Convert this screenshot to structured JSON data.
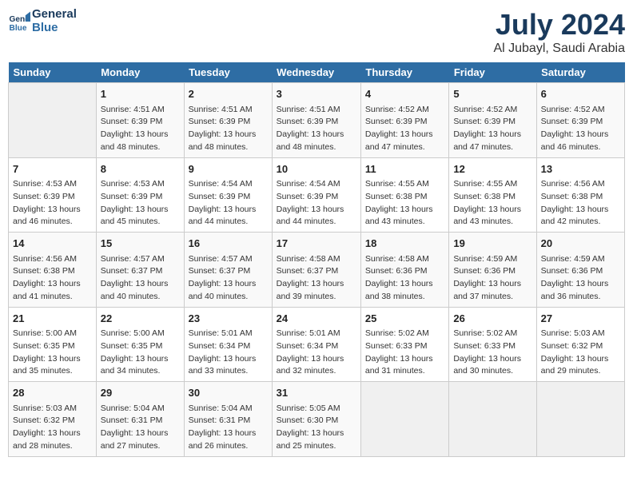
{
  "header": {
    "logo_line1": "General",
    "logo_line2": "Blue",
    "month": "July 2024",
    "location": "Al Jubayl, Saudi Arabia"
  },
  "weekdays": [
    "Sunday",
    "Monday",
    "Tuesday",
    "Wednesday",
    "Thursday",
    "Friday",
    "Saturday"
  ],
  "weeks": [
    [
      {
        "day": "",
        "sunrise": "",
        "sunset": "",
        "daylight": ""
      },
      {
        "day": "1",
        "sunrise": "Sunrise: 4:51 AM",
        "sunset": "Sunset: 6:39 PM",
        "daylight": "Daylight: 13 hours and 48 minutes."
      },
      {
        "day": "2",
        "sunrise": "Sunrise: 4:51 AM",
        "sunset": "Sunset: 6:39 PM",
        "daylight": "Daylight: 13 hours and 48 minutes."
      },
      {
        "day": "3",
        "sunrise": "Sunrise: 4:51 AM",
        "sunset": "Sunset: 6:39 PM",
        "daylight": "Daylight: 13 hours and 48 minutes."
      },
      {
        "day": "4",
        "sunrise": "Sunrise: 4:52 AM",
        "sunset": "Sunset: 6:39 PM",
        "daylight": "Daylight: 13 hours and 47 minutes."
      },
      {
        "day": "5",
        "sunrise": "Sunrise: 4:52 AM",
        "sunset": "Sunset: 6:39 PM",
        "daylight": "Daylight: 13 hours and 47 minutes."
      },
      {
        "day": "6",
        "sunrise": "Sunrise: 4:52 AM",
        "sunset": "Sunset: 6:39 PM",
        "daylight": "Daylight: 13 hours and 46 minutes."
      }
    ],
    [
      {
        "day": "7",
        "sunrise": "Sunrise: 4:53 AM",
        "sunset": "Sunset: 6:39 PM",
        "daylight": "Daylight: 13 hours and 46 minutes."
      },
      {
        "day": "8",
        "sunrise": "Sunrise: 4:53 AM",
        "sunset": "Sunset: 6:39 PM",
        "daylight": "Daylight: 13 hours and 45 minutes."
      },
      {
        "day": "9",
        "sunrise": "Sunrise: 4:54 AM",
        "sunset": "Sunset: 6:39 PM",
        "daylight": "Daylight: 13 hours and 44 minutes."
      },
      {
        "day": "10",
        "sunrise": "Sunrise: 4:54 AM",
        "sunset": "Sunset: 6:39 PM",
        "daylight": "Daylight: 13 hours and 44 minutes."
      },
      {
        "day": "11",
        "sunrise": "Sunrise: 4:55 AM",
        "sunset": "Sunset: 6:38 PM",
        "daylight": "Daylight: 13 hours and 43 minutes."
      },
      {
        "day": "12",
        "sunrise": "Sunrise: 4:55 AM",
        "sunset": "Sunset: 6:38 PM",
        "daylight": "Daylight: 13 hours and 43 minutes."
      },
      {
        "day": "13",
        "sunrise": "Sunrise: 4:56 AM",
        "sunset": "Sunset: 6:38 PM",
        "daylight": "Daylight: 13 hours and 42 minutes."
      }
    ],
    [
      {
        "day": "14",
        "sunrise": "Sunrise: 4:56 AM",
        "sunset": "Sunset: 6:38 PM",
        "daylight": "Daylight: 13 hours and 41 minutes."
      },
      {
        "day": "15",
        "sunrise": "Sunrise: 4:57 AM",
        "sunset": "Sunset: 6:37 PM",
        "daylight": "Daylight: 13 hours and 40 minutes."
      },
      {
        "day": "16",
        "sunrise": "Sunrise: 4:57 AM",
        "sunset": "Sunset: 6:37 PM",
        "daylight": "Daylight: 13 hours and 40 minutes."
      },
      {
        "day": "17",
        "sunrise": "Sunrise: 4:58 AM",
        "sunset": "Sunset: 6:37 PM",
        "daylight": "Daylight: 13 hours and 39 minutes."
      },
      {
        "day": "18",
        "sunrise": "Sunrise: 4:58 AM",
        "sunset": "Sunset: 6:36 PM",
        "daylight": "Daylight: 13 hours and 38 minutes."
      },
      {
        "day": "19",
        "sunrise": "Sunrise: 4:59 AM",
        "sunset": "Sunset: 6:36 PM",
        "daylight": "Daylight: 13 hours and 37 minutes."
      },
      {
        "day": "20",
        "sunrise": "Sunrise: 4:59 AM",
        "sunset": "Sunset: 6:36 PM",
        "daylight": "Daylight: 13 hours and 36 minutes."
      }
    ],
    [
      {
        "day": "21",
        "sunrise": "Sunrise: 5:00 AM",
        "sunset": "Sunset: 6:35 PM",
        "daylight": "Daylight: 13 hours and 35 minutes."
      },
      {
        "day": "22",
        "sunrise": "Sunrise: 5:00 AM",
        "sunset": "Sunset: 6:35 PM",
        "daylight": "Daylight: 13 hours and 34 minutes."
      },
      {
        "day": "23",
        "sunrise": "Sunrise: 5:01 AM",
        "sunset": "Sunset: 6:34 PM",
        "daylight": "Daylight: 13 hours and 33 minutes."
      },
      {
        "day": "24",
        "sunrise": "Sunrise: 5:01 AM",
        "sunset": "Sunset: 6:34 PM",
        "daylight": "Daylight: 13 hours and 32 minutes."
      },
      {
        "day": "25",
        "sunrise": "Sunrise: 5:02 AM",
        "sunset": "Sunset: 6:33 PM",
        "daylight": "Daylight: 13 hours and 31 minutes."
      },
      {
        "day": "26",
        "sunrise": "Sunrise: 5:02 AM",
        "sunset": "Sunset: 6:33 PM",
        "daylight": "Daylight: 13 hours and 30 minutes."
      },
      {
        "day": "27",
        "sunrise": "Sunrise: 5:03 AM",
        "sunset": "Sunset: 6:32 PM",
        "daylight": "Daylight: 13 hours and 29 minutes."
      }
    ],
    [
      {
        "day": "28",
        "sunrise": "Sunrise: 5:03 AM",
        "sunset": "Sunset: 6:32 PM",
        "daylight": "Daylight: 13 hours and 28 minutes."
      },
      {
        "day": "29",
        "sunrise": "Sunrise: 5:04 AM",
        "sunset": "Sunset: 6:31 PM",
        "daylight": "Daylight: 13 hours and 27 minutes."
      },
      {
        "day": "30",
        "sunrise": "Sunrise: 5:04 AM",
        "sunset": "Sunset: 6:31 PM",
        "daylight": "Daylight: 13 hours and 26 minutes."
      },
      {
        "day": "31",
        "sunrise": "Sunrise: 5:05 AM",
        "sunset": "Sunset: 6:30 PM",
        "daylight": "Daylight: 13 hours and 25 minutes."
      },
      {
        "day": "",
        "sunrise": "",
        "sunset": "",
        "daylight": ""
      },
      {
        "day": "",
        "sunrise": "",
        "sunset": "",
        "daylight": ""
      },
      {
        "day": "",
        "sunrise": "",
        "sunset": "",
        "daylight": ""
      }
    ]
  ]
}
